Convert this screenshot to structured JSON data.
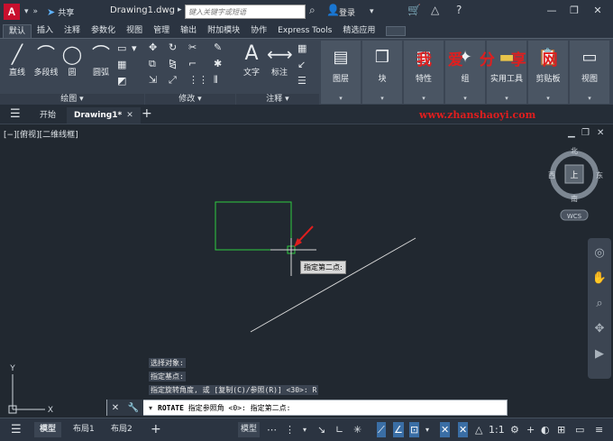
{
  "titlebar": {
    "app_logo": "A",
    "share": "共享",
    "document": "Drawing1.dwg",
    "search_placeholder": "键入关键字或短语",
    "login": "登录"
  },
  "ribbon_tabs": [
    "默认",
    "插入",
    "注释",
    "参数化",
    "视图",
    "管理",
    "输出",
    "附加模块",
    "协作",
    "Express Tools",
    "精选应用"
  ],
  "draw_panel": {
    "tools": [
      "直线",
      "多段线",
      "圆",
      "圆弧"
    ],
    "footer": "绘图 ▾"
  },
  "modify_panel": {
    "footer": "修改 ▾"
  },
  "annotation_panel": {
    "tools": [
      "文字",
      "标注"
    ],
    "footer": "注释 ▾"
  },
  "big_buttons": [
    "图层",
    "块",
    "特性",
    "组",
    "实用工具",
    "剪贴板",
    "视图"
  ],
  "watermark": {
    "title": "我 爱 分 享 网",
    "url": "www.zhanshaoyi.com"
  },
  "doc_tabs": {
    "start": "开始",
    "active": "Drawing1*"
  },
  "canvas": {
    "view_label": "[−][俯视][二维线框]",
    "viewcube": {
      "north": "北",
      "south": "南",
      "east": "东",
      "west": "西",
      "face": "上",
      "wcs": "WCS"
    },
    "ucs": {
      "x": "X",
      "y": "Y"
    },
    "tooltip": "指定第二点:"
  },
  "command_history": [
    "选择对象:",
    "指定基点:",
    "指定旋转角度, 或 [复制(C)/参照(R)] <30>:  R"
  ],
  "command_line": {
    "command": "ROTATE",
    "prompt": " 指定参照角 <0>:  指定第二点:"
  },
  "statusbar": {
    "tabs": [
      "模型",
      "布局1",
      "布局2"
    ],
    "space": "模型",
    "scale": "1:1"
  },
  "colors": {
    "accent": "#3a6ea5",
    "rectangle": "#2ecc40",
    "arrow": "#e01e1e",
    "watermark": "#e01e1e"
  }
}
